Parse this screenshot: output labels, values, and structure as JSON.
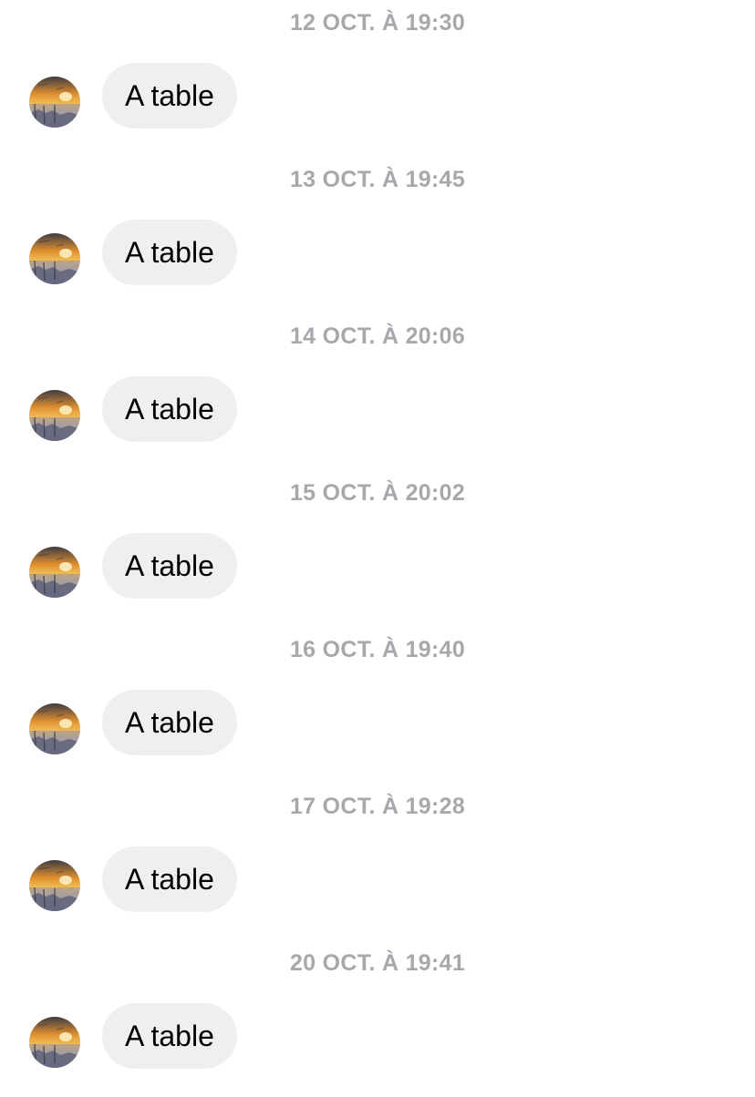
{
  "colors": {
    "background": "#ffffff",
    "timestamp_text": "#a8a8ac",
    "bubble_background": "#efefef",
    "bubble_text": "#000000"
  },
  "avatar_icon": "sunset-photo-avatar",
  "messages": [
    {
      "timestamp": "12 OCT. À 19:30",
      "text": "A table"
    },
    {
      "timestamp": "13 OCT. À 19:45",
      "text": "A table"
    },
    {
      "timestamp": "14 OCT. À 20:06",
      "text": "A table"
    },
    {
      "timestamp": "15 OCT. À 20:02",
      "text": "A table"
    },
    {
      "timestamp": "16 OCT. À 19:40",
      "text": "A table"
    },
    {
      "timestamp": "17 OCT. À 19:28",
      "text": "A table"
    },
    {
      "timestamp": "20 OCT. À 19:41",
      "text": "A table"
    }
  ]
}
